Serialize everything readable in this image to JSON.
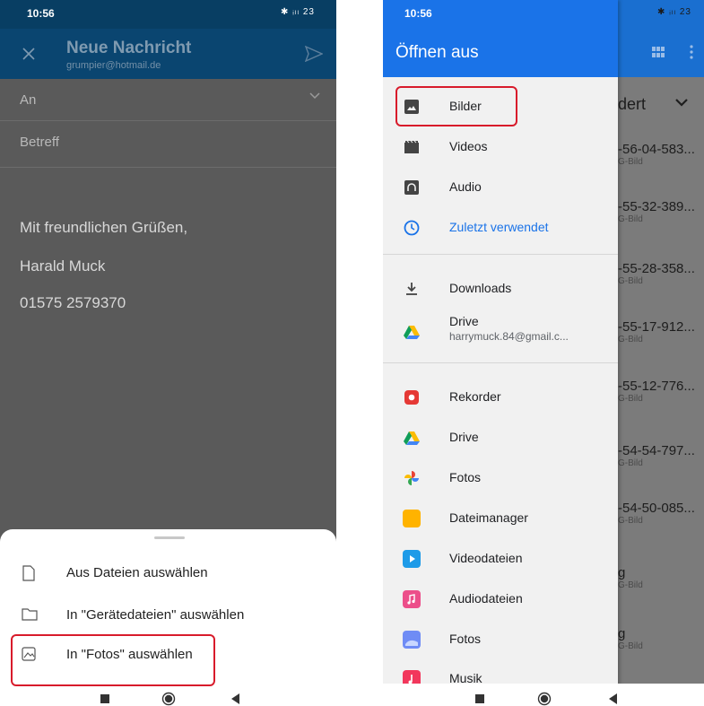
{
  "left": {
    "status": {
      "time": "10:56",
      "icons": "✱ ᵢₗₗ 23"
    },
    "compose": {
      "title": "Neue Nachricht",
      "from": "grumpier@hotmail.de",
      "to_label": "An",
      "subject_label": "Betreff",
      "body_lines": [
        "Mit freundlichen Grüßen,",
        "Harald Muck",
        "01575 2579370"
      ]
    },
    "sheet": {
      "options": [
        {
          "label": "Aus Dateien auswählen",
          "icon": "file-icon"
        },
        {
          "label": "In \"Gerätedateien\" auswählen",
          "icon": "folder-icon"
        },
        {
          "label": "In \"Fotos\" auswählen",
          "icon": "image-icon"
        }
      ]
    }
  },
  "right": {
    "status": {
      "time": "10:56",
      "icons": "✱ ᵢₗₗ 23"
    },
    "drawer": {
      "title": "Öffnen aus",
      "group1": [
        {
          "label": "Bilder",
          "icon": "image-icon"
        },
        {
          "label": "Videos",
          "icon": "video-icon"
        },
        {
          "label": "Audio",
          "icon": "audio-icon"
        },
        {
          "label": "Zuletzt verwendet",
          "icon": "clock-icon"
        }
      ],
      "group2": [
        {
          "label": "Downloads",
          "icon": "download-icon"
        },
        {
          "label": "Drive",
          "sub": "harrymuck.84@gmail.c...",
          "icon": "drive-icon"
        }
      ],
      "group3": [
        {
          "label": "Rekorder",
          "icon": "recorder-icon"
        },
        {
          "label": "Drive",
          "icon": "drive-icon"
        },
        {
          "label": "Fotos",
          "icon": "photos-pinwheel-icon"
        },
        {
          "label": "Dateimanager",
          "icon": "filemanager-icon"
        },
        {
          "label": "Videodateien",
          "icon": "videofiles-icon"
        },
        {
          "label": "Audiodateien",
          "icon": "audiofiles-icon"
        },
        {
          "label": "Fotos",
          "icon": "gallery-icon"
        },
        {
          "label": "Musik",
          "icon": "music-icon"
        }
      ]
    },
    "background": {
      "sort_label": "dert",
      "files": [
        {
          "name": "-56-04-583...",
          "type": "G-Bild"
        },
        {
          "name": "-55-32-389...",
          "type": "G-Bild"
        },
        {
          "name": "-55-28-358...",
          "type": "G-Bild"
        },
        {
          "name": "-55-17-912...",
          "type": "G-Bild"
        },
        {
          "name": "-55-12-776...",
          "type": "G-Bild"
        },
        {
          "name": "-54-54-797...",
          "type": "G-Bild"
        },
        {
          "name": "-54-50-085...",
          "type": "G-Bild"
        },
        {
          "name": "g",
          "type": "G-Bild"
        },
        {
          "name": "g",
          "type": "G-Bild"
        }
      ]
    }
  },
  "colors": {
    "accent_blue": "#1a73e8",
    "highlight_red": "#d81b2b",
    "compose_bar": "#0a4570"
  }
}
